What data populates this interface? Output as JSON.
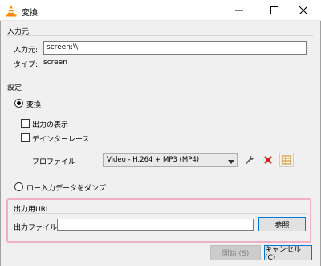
{
  "window": {
    "title": "変換",
    "icon": "vlc-cone-icon"
  },
  "source": {
    "group_label": "入力元",
    "input_label": "入力元:",
    "input_value": "screen:\\\\",
    "type_label": "タイプ:",
    "type_value": "screen"
  },
  "settings": {
    "group_label": "設定",
    "convert_label": "変換",
    "convert_selected": true,
    "show_output_label": "出力の表示",
    "show_output_checked": false,
    "deinterlace_label": "デインターレース",
    "deinterlace_checked": false,
    "profile_label": "プロファイル",
    "profile_value": "Video - H.264 + MP3 (MP4)",
    "raw_dump_label": "ロー入力データをダンプ",
    "raw_dump_selected": false
  },
  "destination": {
    "group_label": "出力用URL",
    "file_label": "出力ファイル:",
    "file_value": "",
    "browse_label": "参照"
  },
  "footer": {
    "start_label": "開始 (S)",
    "cancel_label": "キャンセル (C)"
  },
  "colors": {
    "highlight": "#f2b0c8",
    "vlc_orange": "#ff8800",
    "focus_blue": "#0078d7",
    "delete_red": "#d21f1f"
  }
}
